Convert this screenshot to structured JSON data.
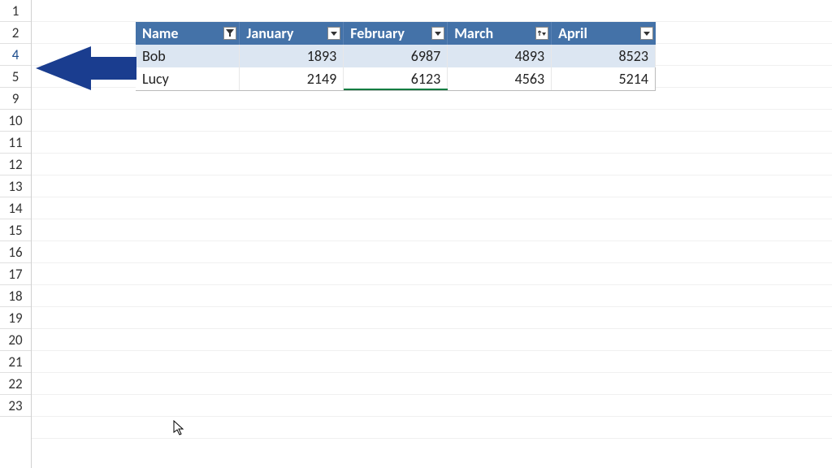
{
  "row_headers": [
    "1",
    "2",
    "4",
    "5",
    "9",
    "10",
    "11",
    "12",
    "13",
    "14",
    "15",
    "16",
    "17",
    "18",
    "19",
    "20",
    "21",
    "22",
    "23"
  ],
  "table": {
    "headers": [
      "Name",
      "January",
      "February",
      "March",
      "April"
    ],
    "rows": [
      {
        "name": "Bob",
        "jan": "1893",
        "feb": "6987",
        "mar": "4893",
        "apr": "8523"
      },
      {
        "name": "Lucy",
        "jan": "2149",
        "feb": "6123",
        "mar": "4563",
        "apr": "5214"
      }
    ]
  },
  "colors": {
    "header_bg": "#4472a8",
    "arrow": "#1a3d8f"
  }
}
